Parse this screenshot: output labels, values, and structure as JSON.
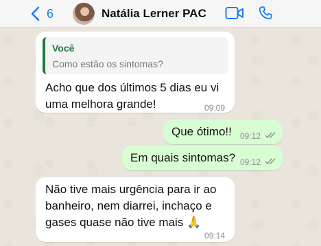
{
  "header": {
    "back_count": "6",
    "contact_name": "Natália Lerner PAC",
    "icons": {
      "back": "chevron-left-icon",
      "video": "video-camera-icon",
      "call": "phone-icon"
    },
    "accent_color": "#1a7cf5"
  },
  "messages": [
    {
      "direction": "incoming",
      "reply_author": "Você",
      "reply_text": "Como estão os sintomas?",
      "lines": [
        "Acho que dos últimos 5 dias eu vi",
        "uma melhora grande!"
      ],
      "time": "09:09"
    },
    {
      "direction": "outgoing",
      "text": "Que ótimo!!",
      "time": "09:12",
      "status": "read"
    },
    {
      "direction": "outgoing",
      "text": "Em quais sintomas?",
      "time": "09:12",
      "status": "read"
    },
    {
      "direction": "incoming",
      "lines": [
        "Não tive mais urgência para ir ao",
        "banheiro, nem diarrei, inchaço e",
        "gases quase não tive mais 🙏"
      ],
      "time": "09:14"
    }
  ],
  "colors": {
    "incoming_bubble": "#ffffff",
    "outgoing_bubble": "#d9fdd3",
    "reply_accent": "#1f7a3e"
  }
}
